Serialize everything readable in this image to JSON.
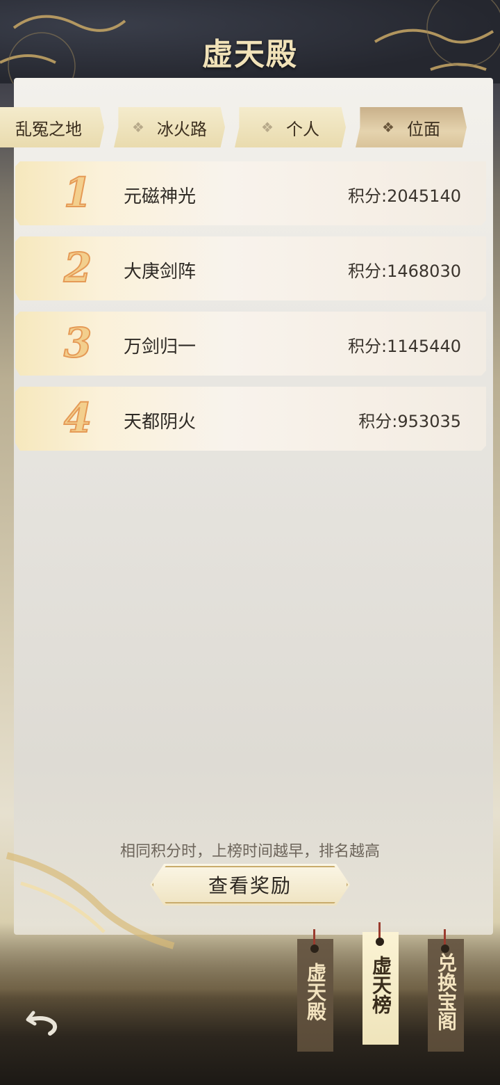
{
  "title": "虚天殿",
  "tabs": [
    {
      "label": "乱冤之地",
      "active": false
    },
    {
      "label": "冰火路",
      "active": false
    },
    {
      "label": "个人",
      "active": false
    },
    {
      "label": "位面",
      "active": true
    }
  ],
  "rankings": [
    {
      "rank": "1",
      "name": "元磁神光",
      "score": "积分:2045140"
    },
    {
      "rank": "2",
      "name": "大庚剑阵",
      "score": "积分:1468030"
    },
    {
      "rank": "3",
      "name": "万剑归一",
      "score": "积分:1145440"
    },
    {
      "rank": "4",
      "name": "天都阴火",
      "score": "积分:953035"
    }
  ],
  "tip": "相同积分时，上榜时间越早，排名越高",
  "reward_button": "查看奖励",
  "side_tags": [
    {
      "label": "虚天殿"
    },
    {
      "label": "虚天榜"
    },
    {
      "label": "兑换宝阁"
    }
  ],
  "icons": {
    "back": "back-arrow-icon",
    "tab_marker": "diamond-icon"
  },
  "colors": {
    "accent_gold": "#e9dbae",
    "rank_orange": "#e59a56"
  }
}
